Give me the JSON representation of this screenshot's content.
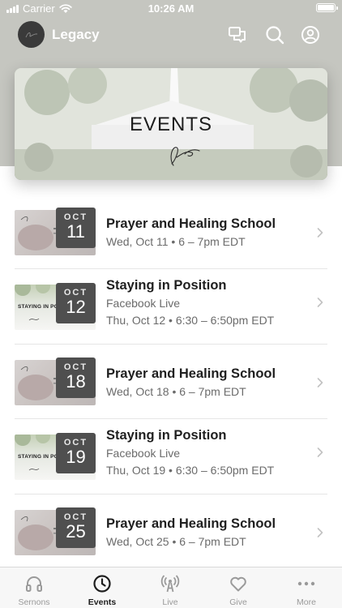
{
  "status_bar": {
    "carrier": "Carrier",
    "time": "10:26 AM"
  },
  "header": {
    "title": "Legacy",
    "icons": [
      "chat-icon",
      "search-icon",
      "account-icon"
    ]
  },
  "hero": {
    "title": "EVENTS"
  },
  "events": [
    {
      "month": "OCT",
      "day": "11",
      "title": "Prayer and Healing School",
      "subtitle": "",
      "datetime": "Wed, Oct 11 • 6 – 7pm EDT",
      "thumb": "prayer",
      "thumb_text": ""
    },
    {
      "month": "OCT",
      "day": "12",
      "title": "Staying in Position",
      "subtitle": "Facebook Live",
      "datetime": "Thu, Oct 12 • 6:30 – 6:50pm EDT",
      "thumb": "staying",
      "thumb_text": "STAYING IN POSITI"
    },
    {
      "month": "OCT",
      "day": "18",
      "title": "Prayer and Healing School",
      "subtitle": "",
      "datetime": "Wed, Oct 18 • 6 – 7pm EDT",
      "thumb": "prayer",
      "thumb_text": ""
    },
    {
      "month": "OCT",
      "day": "19",
      "title": "Staying in Position",
      "subtitle": "Facebook Live",
      "datetime": "Thu, Oct 19 • 6:30 – 6:50pm EDT",
      "thumb": "staying",
      "thumb_text": "STAYING IN POSITI"
    },
    {
      "month": "OCT",
      "day": "25",
      "title": "Prayer and Healing School",
      "subtitle": "",
      "datetime": "Wed, Oct 25 • 6 – 7pm EDT",
      "thumb": "prayer",
      "thumb_text": ""
    }
  ],
  "tabbar": {
    "active": "Events",
    "tabs": [
      {
        "label": "Sernons",
        "icon": "headphones-icon"
      },
      {
        "label": "Events",
        "icon": "clock-icon"
      },
      {
        "label": "Live",
        "icon": "broadcast-icon"
      },
      {
        "label": "Give",
        "icon": "heart-icon"
      },
      {
        "label": "More",
        "icon": "more-icon"
      }
    ]
  },
  "colors": {
    "header_bg": "#c5c6c0",
    "badge_bg": "#4f4f4f",
    "active_tab": "#1e1e1e",
    "inactive_tab": "#9a9a9a"
  }
}
